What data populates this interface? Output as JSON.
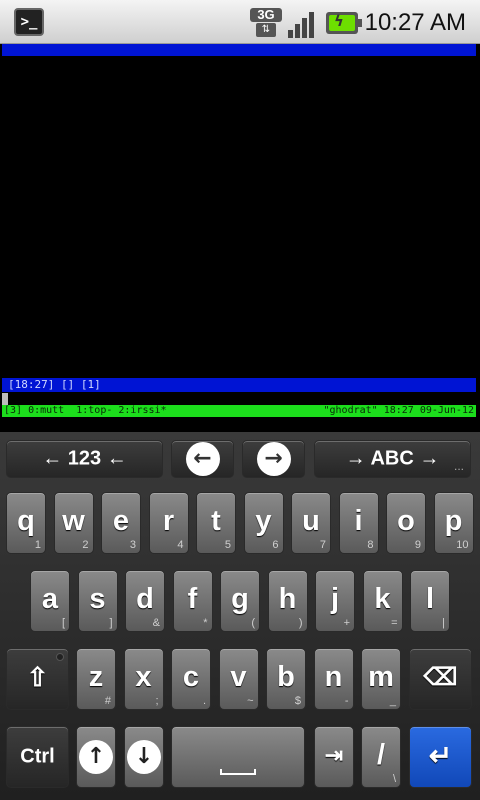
{
  "status_bar": {
    "network_type": "3G",
    "network_arrows": "⇅",
    "time": "10:27 AM",
    "icons": [
      "terminal-app-icon",
      "3g-icon",
      "signal-icon",
      "battery-charging-icon"
    ]
  },
  "terminal": {
    "status_line": "[18:27] [] [1]",
    "screen_bar": {
      "windows": "[3] 0:mutt  1:top- 2:irssi*",
      "host": "\"ghodrat\" 18:27 09-Jun-12"
    }
  },
  "keyboard": {
    "top_row": {
      "num_switch": "← 123 ←",
      "alpha_switch": "→ ABC →",
      "more": "..."
    },
    "row1": [
      {
        "key": "q",
        "sub": "1"
      },
      {
        "key": "w",
        "sub": "2"
      },
      {
        "key": "e",
        "sub": "3"
      },
      {
        "key": "r",
        "sub": "4"
      },
      {
        "key": "t",
        "sub": "5"
      },
      {
        "key": "y",
        "sub": "6"
      },
      {
        "key": "u",
        "sub": "7"
      },
      {
        "key": "i",
        "sub": "8"
      },
      {
        "key": "o",
        "sub": "9"
      },
      {
        "key": "p",
        "sub": "10"
      }
    ],
    "row2": [
      {
        "key": "a",
        "sub": "["
      },
      {
        "key": "s",
        "sub": "]"
      },
      {
        "key": "d",
        "sub": "&"
      },
      {
        "key": "f",
        "sub": "*"
      },
      {
        "key": "g",
        "sub": "("
      },
      {
        "key": "h",
        "sub": ")"
      },
      {
        "key": "j",
        "sub": "+"
      },
      {
        "key": "k",
        "sub": "="
      },
      {
        "key": "l",
        "sub": "|"
      }
    ],
    "row3": [
      {
        "key": "z",
        "sub": "#"
      },
      {
        "key": "x",
        "sub": ";"
      },
      {
        "key": "c",
        "sub": "."
      },
      {
        "key": "v",
        "sub": "~"
      },
      {
        "key": "b",
        "sub": "$"
      },
      {
        "key": "n",
        "sub": "-"
      },
      {
        "key": "m",
        "sub": "_"
      }
    ],
    "bottom_row": {
      "ctrl": "Ctrl",
      "slash": "/",
      "slash_sub": "\\"
    }
  }
}
